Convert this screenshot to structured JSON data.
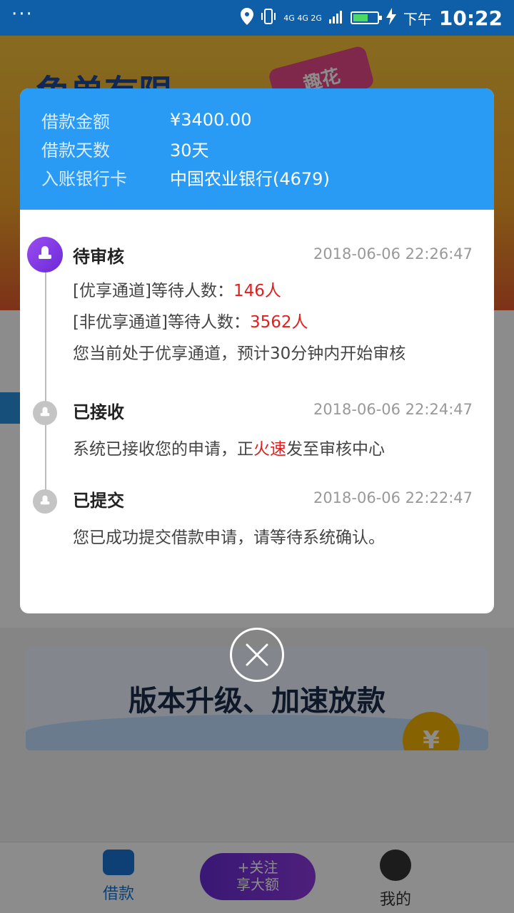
{
  "status_bar": {
    "dots": "···",
    "network": "4G 4G 2G",
    "ampm": "下午",
    "time": "10:22"
  },
  "background": {
    "banner_title": "免单有限",
    "banner_badge": "趣花",
    "promo_text": "版本升级、加速放款",
    "promo_coin": "¥",
    "tabs": [
      {
        "label": "借款"
      },
      {
        "label": "我的"
      }
    ],
    "follow_button": {
      "line1": "+关注",
      "line2": "享大额"
    }
  },
  "modal": {
    "header": [
      {
        "label": "借款金额",
        "value": "¥3400.00"
      },
      {
        "label": "借款天数",
        "value": "30天"
      },
      {
        "label": "入账银行卡",
        "value": "中国农业银行(4679)"
      }
    ],
    "timeline": [
      {
        "title": "待审核",
        "time": "2018-06-06 22:26:47",
        "line1_prefix": "[优享通道]等待人数：",
        "line1_value": "146人",
        "line2_prefix": "[非优享通道]等待人数：",
        "line2_value": "3562人",
        "line3": "您当前处于优享通道，预计30分钟内开始审核"
      },
      {
        "title": "已接收",
        "time": "2018-06-06 22:24:47",
        "text_a": "系统已接收您的申请，正",
        "text_red": "火速",
        "text_b": "发至审核中心"
      },
      {
        "title": "已提交",
        "time": "2018-06-06 22:22:47",
        "text": "您已成功提交借款申请，请等待系统确认。"
      }
    ]
  },
  "colors": {
    "header_blue": "#2a9bf4",
    "accent_red": "#e02020",
    "active_purple": "#7a35e0"
  }
}
